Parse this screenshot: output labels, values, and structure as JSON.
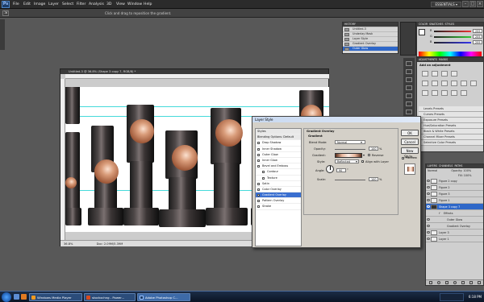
{
  "menubar": {
    "logo": "Ps",
    "items": [
      "File",
      "Edit",
      "Image",
      "Layer",
      "Select",
      "Filter",
      "Analysis",
      "3D",
      "View",
      "Window",
      "Help"
    ],
    "workspace": "ESSENTIALS ▾"
  },
  "options": {
    "hint": "Click and drag to reposition the gradient."
  },
  "history_panel": {
    "title": "HISTORY",
    "items": [
      "Untitled-3",
      "Underlay Mask",
      "Layer Style",
      "Gradient Overlay",
      "Outer Glow"
    ],
    "selected_index": 4
  },
  "color_panel": {
    "tabs": [
      "COLOR",
      "SWATCHES",
      "STYLES"
    ],
    "rows": [
      "R",
      "G",
      "B"
    ],
    "values": [
      "255",
      "255",
      "255"
    ]
  },
  "adjustments_panel": {
    "tabs": [
      "ADJUSTMENTS",
      "MASKS"
    ],
    "heading": "Add an adjustment",
    "presets": [
      "Levels Presets",
      "Curves Presets",
      "Exposure Presets",
      "Hue/Saturation Presets",
      "Black & White Presets",
      "Channel Mixer Presets",
      "Selective Color Presets"
    ]
  },
  "document": {
    "title": "Untitled-3 @ 36.8% (Shape 3 copy 7, RGB/8) *",
    "zoom": "36.8%",
    "doc_size": "Doc: 2.09M/5.39M"
  },
  "layer_style_dialog": {
    "title": "Layer Style",
    "styles": [
      {
        "label": "Styles",
        "checked": null
      },
      {
        "label": "Blending Options: Default",
        "checked": null
      },
      {
        "label": "Drop Shadow",
        "checked": false
      },
      {
        "label": "Inner Shadow",
        "checked": false
      },
      {
        "label": "Outer Glow",
        "checked": false
      },
      {
        "label": "Inner Glow",
        "checked": false
      },
      {
        "label": "Bevel and Emboss",
        "checked": false
      },
      {
        "label": "Contour",
        "checked": false
      },
      {
        "label": "Texture",
        "checked": false
      },
      {
        "label": "Satin",
        "checked": false
      },
      {
        "label": "Color Overlay",
        "checked": false
      },
      {
        "label": "Gradient Overlay",
        "checked": true
      },
      {
        "label": "Pattern Overlay",
        "checked": false
      },
      {
        "label": "Stroke",
        "checked": false
      }
    ],
    "selected_index": 11,
    "section_title": "Gradient Overlay",
    "group_title": "Gradient",
    "blend_mode_label": "Blend Mode:",
    "blend_mode": "Normal",
    "opacity_label": "Opacity:",
    "opacity": "100",
    "gradient_label": "Gradient:",
    "reverse_label": "Reverse",
    "style_label": "Style:",
    "style": "Reflected",
    "align_label": "Align with Layer",
    "angle_label": "Angle:",
    "angle": "90",
    "scale_label": "Scale:",
    "scale": "100",
    "percent": "%",
    "degree": "°",
    "buttons": {
      "ok": "OK",
      "cancel": "Cancel",
      "new_style": "New Style...",
      "preview": "Preview"
    },
    "gradient_colors": [
      "#5a2e1c",
      "#e8b79c",
      "#fff0e6",
      "#e8b79c",
      "#5a2e1c"
    ]
  },
  "layers_panel": {
    "tabs": [
      "LAYERS",
      "CHANNELS",
      "PATHS"
    ],
    "blend": "Normal",
    "opacity_label": "Opacity:",
    "opacity": "100%",
    "fill_label": "Fill:",
    "fill": "100%",
    "layers": [
      {
        "name": "Figure 2 copy",
        "selected": false
      },
      {
        "name": "Figure 2",
        "selected": false
      },
      {
        "name": "Figure 3",
        "selected": false
      },
      {
        "name": "Figure 1",
        "selected": false
      },
      {
        "name": "Shape 3 copy 7",
        "selected": true
      },
      {
        "name": "Effects",
        "selected": false
      },
      {
        "name": "Outer Glow",
        "selected": false
      },
      {
        "name": "Gradient Overlay",
        "selected": false
      },
      {
        "name": "Layer 3",
        "selected": false
      },
      {
        "name": "Layer 1",
        "selected": false
      }
    ]
  },
  "taskbar": {
    "items": [
      "Windows Media Player",
      "stockxchng - Power...",
      "Adobe Photoshop C..."
    ],
    "clock": "6:18 PM"
  },
  "colors": {
    "selection": "#2e67c8",
    "guide": "#24d3d3",
    "copper": "#c9856a"
  }
}
